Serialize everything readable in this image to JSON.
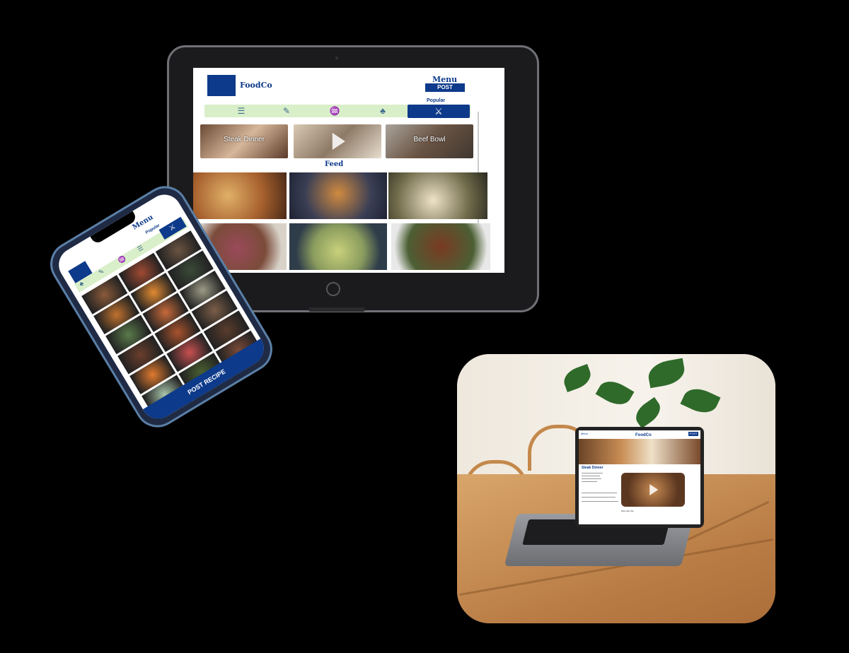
{
  "tablet": {
    "brand": "FoodCo",
    "menu_label": "Menu",
    "post_label": "POST",
    "popular_label": "Popular",
    "categories": [
      {
        "icon": "burger-icon",
        "glyph": "☰"
      },
      {
        "icon": "carrot-icon",
        "glyph": "✎"
      },
      {
        "icon": "fish-icon",
        "glyph": "♒"
      },
      {
        "icon": "vegetables-icon",
        "glyph": "♣"
      },
      {
        "icon": "utensils-icon",
        "glyph": "⚔"
      }
    ],
    "stories": [
      {
        "label": "Steak Dinner"
      },
      {
        "label": ""
      },
      {
        "label": "Beef Bowl"
      }
    ],
    "feed_title": "Feed",
    "feed_tiles": [
      {
        "name": "pizza",
        "color": "#a7612e"
      },
      {
        "name": "french-toast",
        "color": "#3b3f55"
      },
      {
        "name": "salmon-plate",
        "color": "#6f6a4a"
      },
      {
        "name": "burger",
        "color": "#7b4b3a"
      },
      {
        "name": "grain-bowl",
        "color": "#8a9c5e"
      },
      {
        "name": "meatballs",
        "color": "#4c5f34"
      }
    ]
  },
  "phone": {
    "menu_label": "Menu",
    "popular_label": "Popular",
    "post_recipe_label": "POST RECIPE",
    "tile_colors": [
      "#8a5a3a",
      "#a04a32",
      "#6b5442",
      "#c0722e",
      "#e28a32",
      "#3a4a38",
      "#5a7a4a",
      "#c86a3a",
      "#9c9a86",
      "#6a3e2c",
      "#a8522c",
      "#7b5e48",
      "#e07a2e",
      "#c85050",
      "#5a3c2c",
      "#a8c5aa",
      "#4a6030",
      "#7a4a38",
      "#d4883a",
      "#6a7a5a",
      "#3a2a2a"
    ]
  },
  "laptop": {
    "brand": "FoodCo",
    "menu_label": "Menu",
    "post_label": "POST",
    "recipe_title": "Steak Dinner",
    "more_label": "More like this"
  }
}
